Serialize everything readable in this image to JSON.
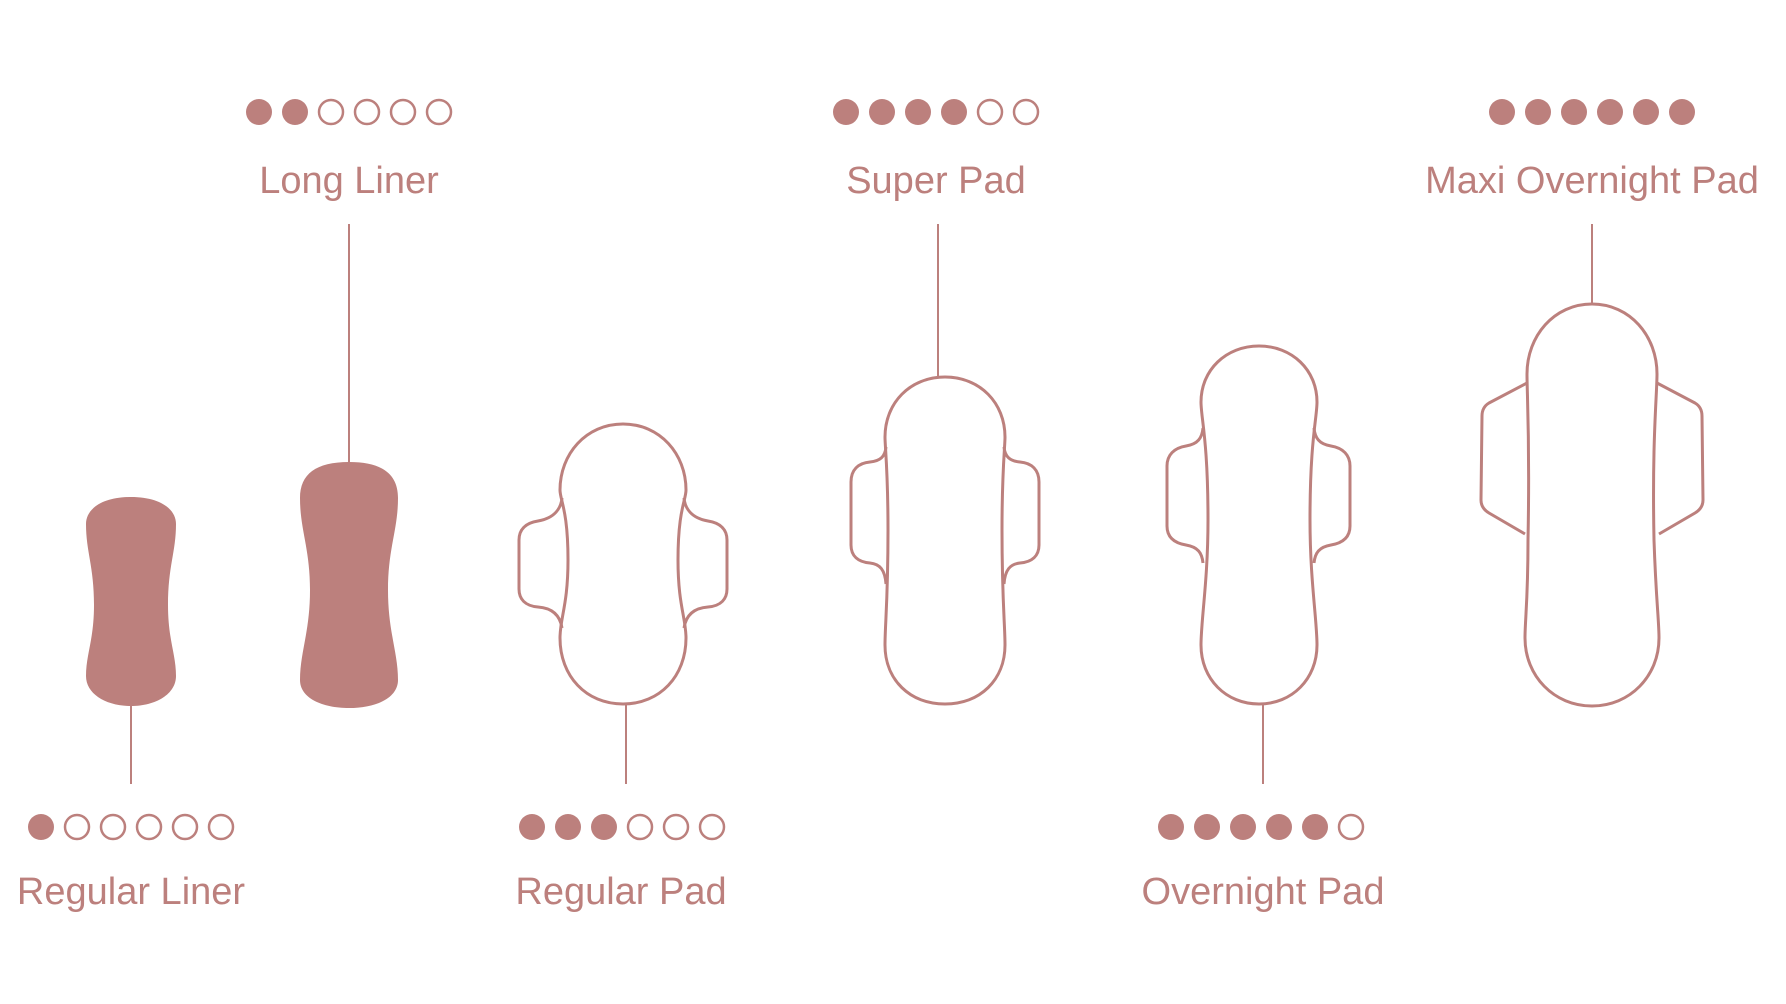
{
  "colors": {
    "accent": "#bc807d",
    "background": "#ffffff"
  },
  "absorbency_scale_max": 6,
  "products": [
    {
      "id": "regular-liner",
      "name": "Regular Liner",
      "absorbency": 1,
      "style": "liner-filled"
    },
    {
      "id": "long-liner",
      "name": "Long Liner",
      "absorbency": 2,
      "style": "liner-filled"
    },
    {
      "id": "regular-pad",
      "name": "Regular Pad",
      "absorbency": 3,
      "style": "pad-outline"
    },
    {
      "id": "super-pad",
      "name": "Super Pad",
      "absorbency": 4,
      "style": "pad-outline"
    },
    {
      "id": "overnight-pad",
      "name": "Overnight Pad",
      "absorbency": 5,
      "style": "pad-outline"
    },
    {
      "id": "maxi-overnight-pad",
      "name": "Maxi Overnight Pad",
      "absorbency": 6,
      "style": "pad-outline"
    }
  ]
}
